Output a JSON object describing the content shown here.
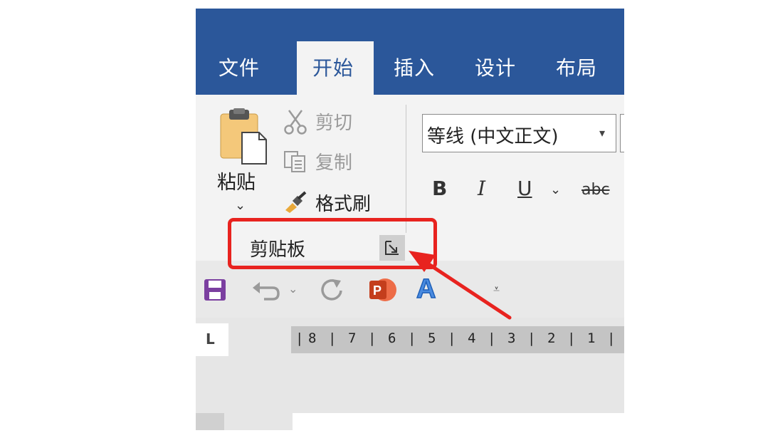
{
  "tabs": [
    "文件",
    "开始",
    "插入",
    "设计",
    "布局"
  ],
  "active_tab": "开始",
  "clipboard": {
    "paste_label": "粘贴",
    "cut_label": "剪切",
    "copy_label": "复制",
    "format_painter_label": "格式刷",
    "group_label": "剪贴板"
  },
  "font": {
    "name_value": "等线 (中文正文)",
    "bold": "B",
    "italic": "I",
    "underline": "U",
    "strikethrough": "abc"
  },
  "ruler": {
    "tab_selector": "L",
    "numbers": [
      "8",
      "7",
      "6",
      "5",
      "4",
      "3",
      "2",
      "1"
    ]
  },
  "colors": {
    "title_bar": "#2b579a",
    "annotation": "#e8231f",
    "ribbon": "#f3f3f3"
  },
  "icons": {
    "paste": "clipboard-paste-icon",
    "cut": "scissors-icon",
    "copy": "copy-icon",
    "format_painter": "paintbrush-icon",
    "launcher": "dialog-launcher-icon",
    "save": "save-icon",
    "undo": "undo-icon",
    "redo": "redo-icon",
    "powerpoint": "powerpoint-icon",
    "text_effects": "text-effect-icon",
    "customize": "customize-qat-icon"
  }
}
